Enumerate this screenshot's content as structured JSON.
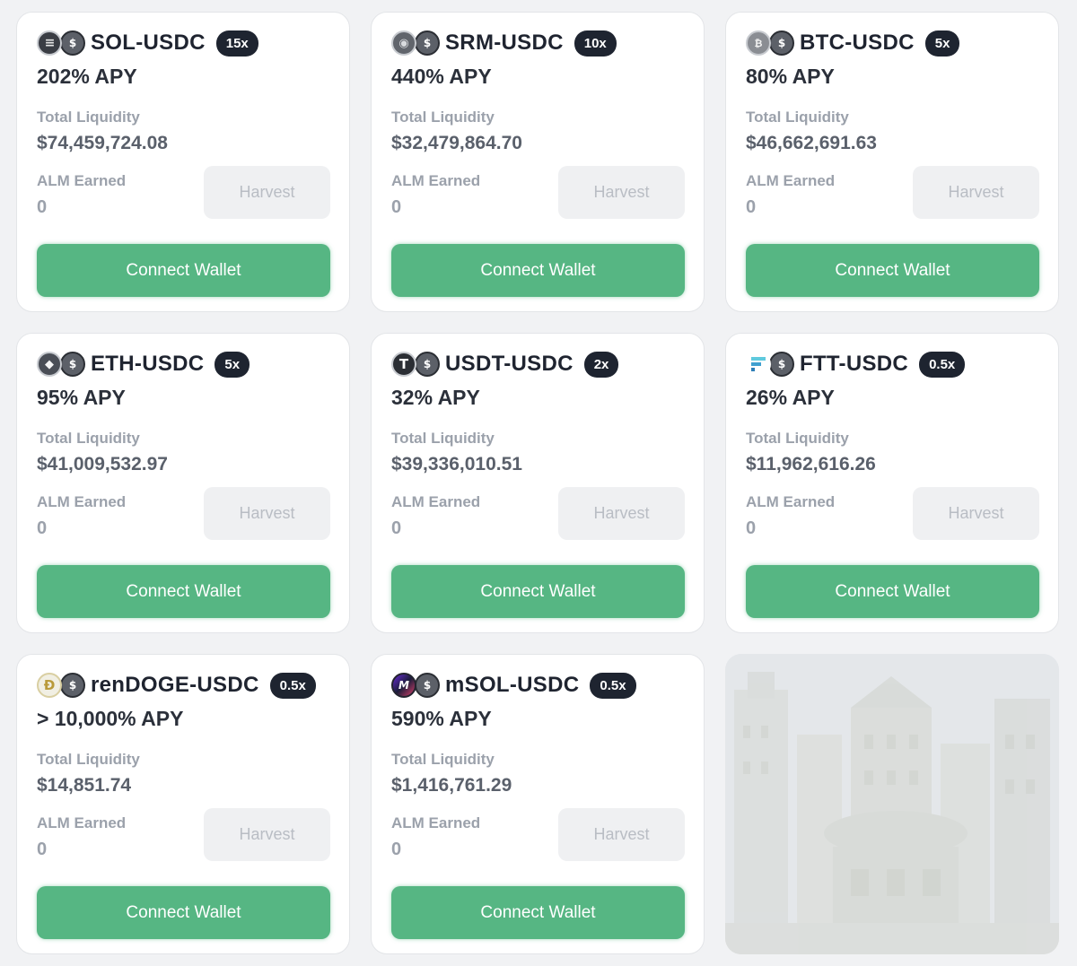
{
  "labels": {
    "total_liquidity": "Total Liquidity",
    "alm_earned": "ALM Earned",
    "harvest": "Harvest",
    "connect_wallet": "Connect Wallet"
  },
  "colors": {
    "connect_button": "#56b683",
    "badge_bg": "#1e2430",
    "harvest_bg": "#eff0f2",
    "page_bg": "#f1f2f4"
  },
  "pools": [
    {
      "pair": "SOL-USDC",
      "leverage": "15x",
      "apy": "202% APY",
      "total_liquidity": "$74,459,724.08",
      "alm_earned": "0",
      "base_icon": "solana-icon",
      "quote_icon": "usdc-icon"
    },
    {
      "pair": "SRM-USDC",
      "leverage": "10x",
      "apy": "440% APY",
      "total_liquidity": "$32,479,864.70",
      "alm_earned": "0",
      "base_icon": "serum-icon",
      "quote_icon": "usdc-icon"
    },
    {
      "pair": "BTC-USDC",
      "leverage": "5x",
      "apy": "80% APY",
      "total_liquidity": "$46,662,691.63",
      "alm_earned": "0",
      "base_icon": "bitcoin-icon",
      "quote_icon": "usdc-icon"
    },
    {
      "pair": "ETH-USDC",
      "leverage": "5x",
      "apy": "95% APY",
      "total_liquidity": "$41,009,532.97",
      "alm_earned": "0",
      "base_icon": "ethereum-icon",
      "quote_icon": "usdc-icon"
    },
    {
      "pair": "USDT-USDC",
      "leverage": "2x",
      "apy": "32% APY",
      "total_liquidity": "$39,336,010.51",
      "alm_earned": "0",
      "base_icon": "tether-icon",
      "quote_icon": "usdc-icon"
    },
    {
      "pair": "FTT-USDC",
      "leverage": "0.5x",
      "apy": "26% APY",
      "total_liquidity": "$11,962,616.26",
      "alm_earned": "0",
      "base_icon": "ftx-token-icon",
      "quote_icon": "usdc-icon"
    },
    {
      "pair": "renDOGE-USDC",
      "leverage": "0.5x",
      "apy": "> 10,000% APY",
      "total_liquidity": "$14,851.74",
      "alm_earned": "0",
      "base_icon": "dogecoin-icon",
      "quote_icon": "usdc-icon"
    },
    {
      "pair": "mSOL-USDC",
      "leverage": "0.5x",
      "apy": "590% APY",
      "total_liquidity": "$1,416,761.29",
      "alm_earned": "0",
      "base_icon": "marinade-sol-icon",
      "quote_icon": "usdc-icon"
    }
  ]
}
